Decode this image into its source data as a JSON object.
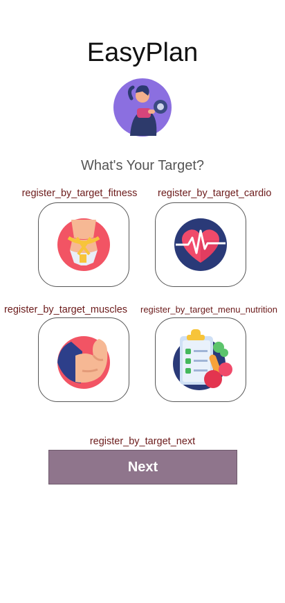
{
  "app": {
    "title": "EasyPlan"
  },
  "screen": {
    "subtitle": "What's Your Target?"
  },
  "targets": [
    {
      "label": "register_by_target_fitness",
      "icon": "waist-measure-icon"
    },
    {
      "label": "register_by_target_cardio",
      "icon": "heartbeat-icon"
    },
    {
      "label": "register_by_target_muscles",
      "icon": "flexed-arm-icon"
    },
    {
      "label": "register_by_target_menu_nutrition",
      "icon": "nutrition-checklist-icon"
    }
  ],
  "next": {
    "label": "register_by_target_next",
    "button_text": "Next"
  },
  "colors": {
    "button": "#8f758c",
    "label_text": "#6b1a1a",
    "tile_border": "#555555"
  }
}
